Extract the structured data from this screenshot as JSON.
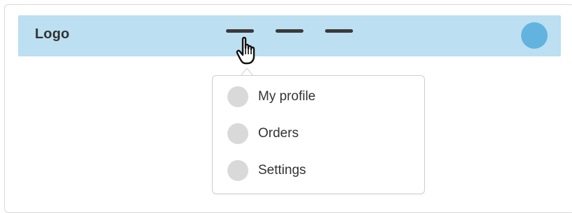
{
  "navbar": {
    "logo_text": "Logo",
    "background_color": "#bcdff1",
    "nav_items": [
      {
        "label": ""
      },
      {
        "label": ""
      },
      {
        "label": ""
      }
    ],
    "avatar_color": "#63b3df"
  },
  "dropdown": {
    "items": [
      {
        "label": "My profile",
        "icon": "circle-placeholder-icon"
      },
      {
        "label": "Orders",
        "icon": "circle-placeholder-icon"
      },
      {
        "label": "Settings",
        "icon": "circle-placeholder-icon"
      }
    ]
  },
  "cursor": {
    "icon": "hand-pointer-cursor-icon"
  }
}
